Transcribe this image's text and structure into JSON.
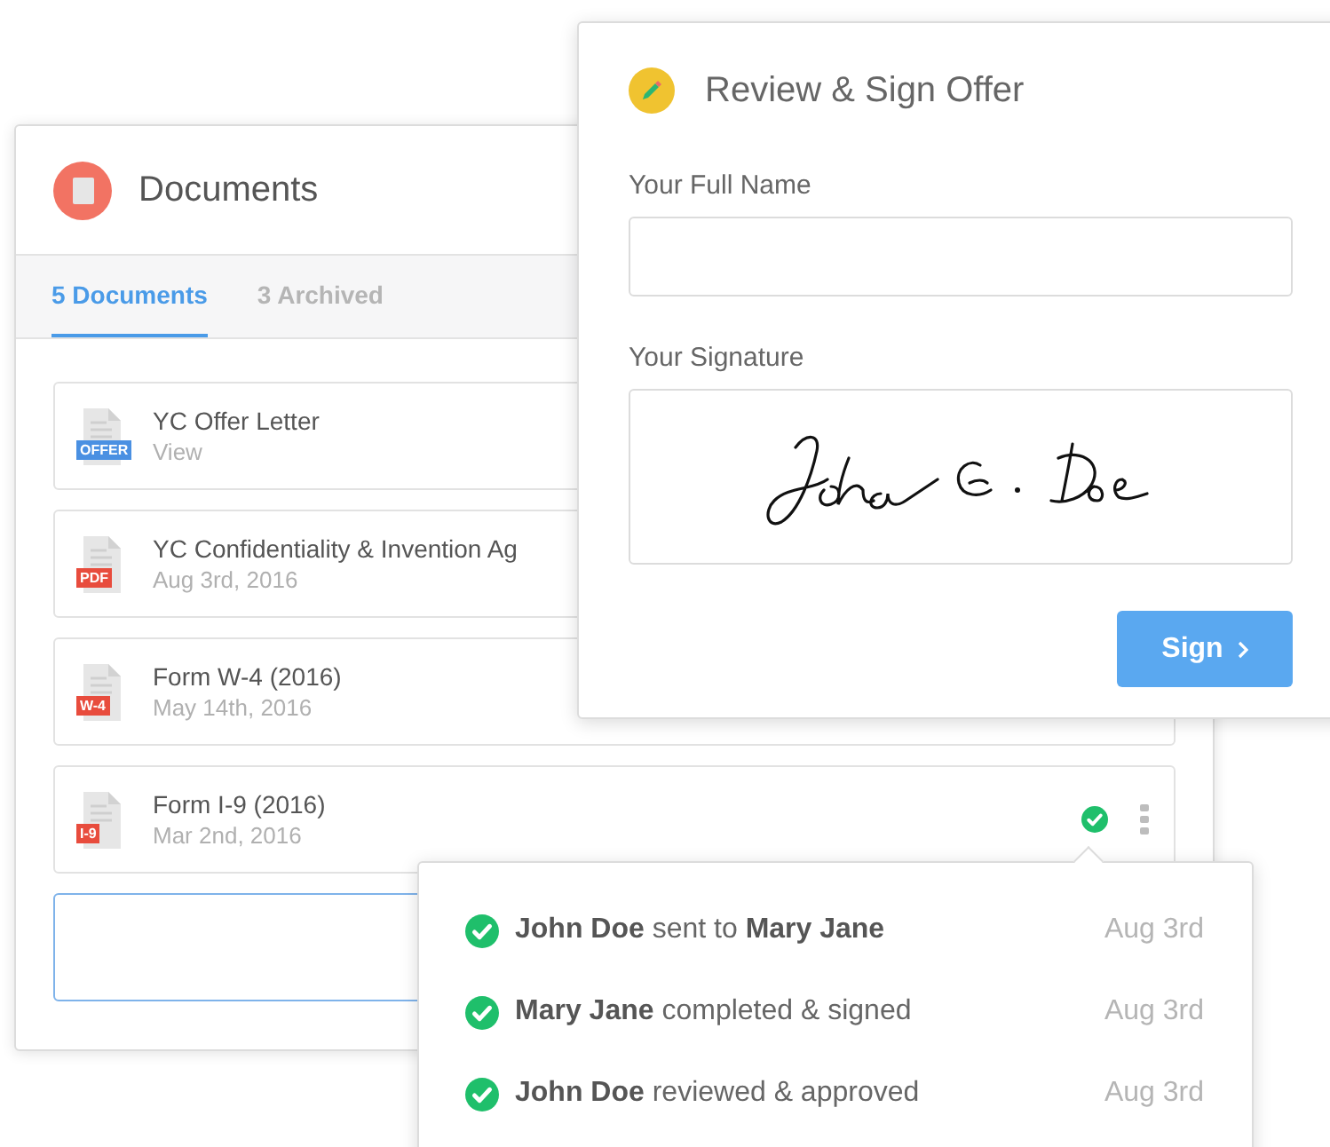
{
  "documents_panel": {
    "title": "Documents",
    "tabs": [
      {
        "label": "5 Documents",
        "selected": true
      },
      {
        "label": "3 Archived",
        "selected": false
      }
    ],
    "items": [
      {
        "name": "YC Offer Letter",
        "subtitle": "View",
        "badge": "OFFER",
        "color": "#4a90e2"
      },
      {
        "name": "YC Confidentiality & Invention Ag",
        "subtitle": "Aug 3rd, 2016",
        "badge": "PDF",
        "color": "#e84c3d"
      },
      {
        "name": "Form W-4 (2016)",
        "subtitle": "May 14th, 2016",
        "badge": "W-4",
        "color": "#e84c3d"
      },
      {
        "name": "Form I-9 (2016)",
        "subtitle": "Mar 2nd, 2016",
        "badge": "I-9",
        "color": "#e84c3d",
        "verified": true
      }
    ]
  },
  "sign_panel": {
    "title": "Review & Sign Offer",
    "name_label": "Your Full Name",
    "signature_label": "Your Signature",
    "button": "Sign"
  },
  "activity": [
    {
      "text": "**John Doe** sent to **Mary Jane**",
      "date": "Aug 3rd"
    },
    {
      "text": "**Mary Jane** completed & signed",
      "date": "Aug 3rd"
    },
    {
      "text": "**John Doe** reviewed & approved",
      "date": "Aug 3rd"
    }
  ]
}
